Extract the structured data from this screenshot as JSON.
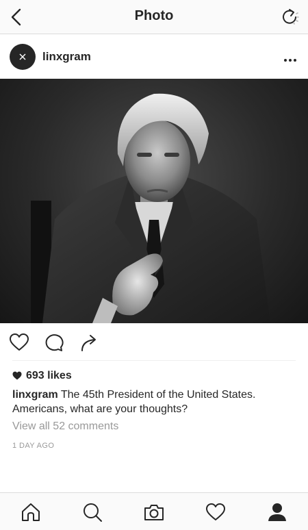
{
  "nav": {
    "title": "Photo",
    "back_icon": "chevron-left-icon",
    "refresh_icon": "refresh-icon"
  },
  "post": {
    "username": "linxgram",
    "avatar_icon": "close-icon",
    "more_icon": "more-horizontal-icon",
    "photo_alt": "Black and white portrait of a man in a suit pointing at the camera",
    "actions": [
      "heart-icon",
      "comment-icon",
      "share-icon"
    ],
    "likes": "693 likes",
    "caption_user": "linxgram",
    "caption_text": "The 45th President of the United States. Americans, what are your thoughts?",
    "view_comments": "View all 52 comments",
    "timestamp": "1 DAY AGO"
  },
  "tabs": [
    "home-icon",
    "search-icon",
    "camera-icon",
    "activity-heart-icon",
    "profile-icon"
  ],
  "colors": {
    "text": "#262626",
    "muted": "#999999",
    "bar_bg": "#fafafa",
    "border": "#dbdbdb"
  }
}
